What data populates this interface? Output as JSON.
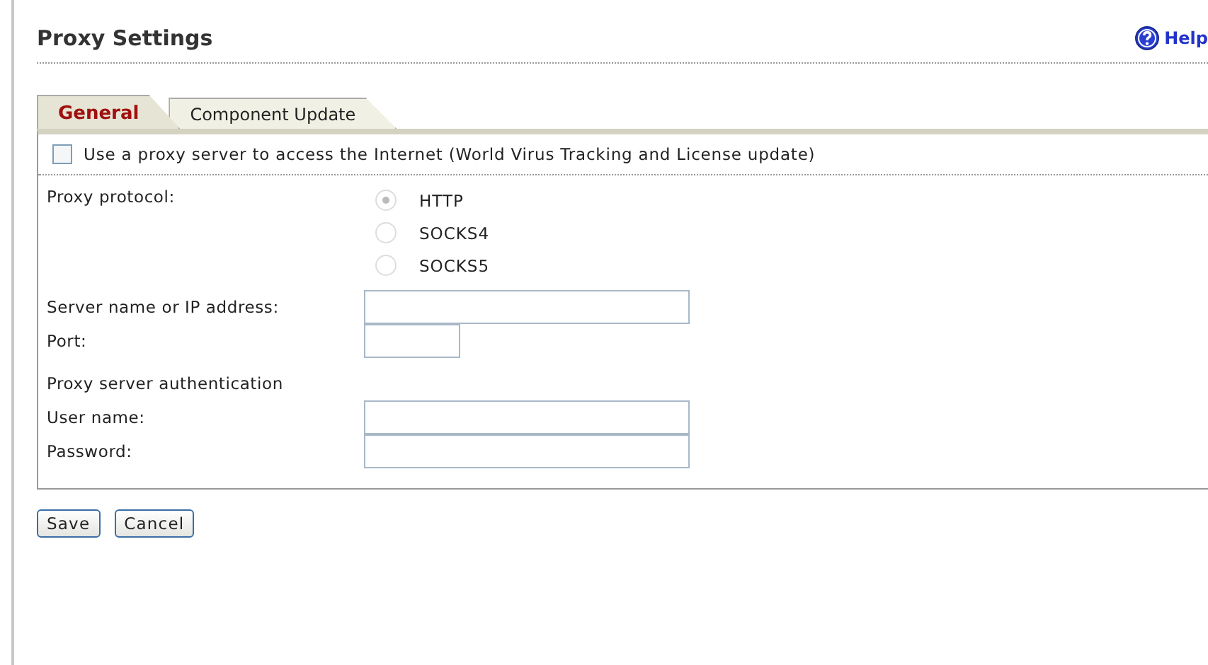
{
  "page": {
    "title": "Proxy Settings",
    "help": "Help"
  },
  "tabs": [
    {
      "label": "General",
      "selected": true
    },
    {
      "label": "Component Update",
      "selected": false
    }
  ],
  "use_proxy": {
    "label": "Use a proxy server to access the Internet (World Virus Tracking and License update)",
    "checked": false
  },
  "protocol": {
    "label": "Proxy protocol:",
    "options": [
      {
        "label": "HTTP",
        "selected": true
      },
      {
        "label": "SOCKS4",
        "selected": false
      },
      {
        "label": "SOCKS5",
        "selected": false
      }
    ]
  },
  "server": {
    "label": "Server name or IP address:"
  },
  "port": {
    "label": "Port:"
  },
  "auth_heading": "Proxy server authentication",
  "username": {
    "label": "User name:"
  },
  "password": {
    "label": "Password:"
  },
  "buttons": [
    "Save",
    "Cancel"
  ]
}
